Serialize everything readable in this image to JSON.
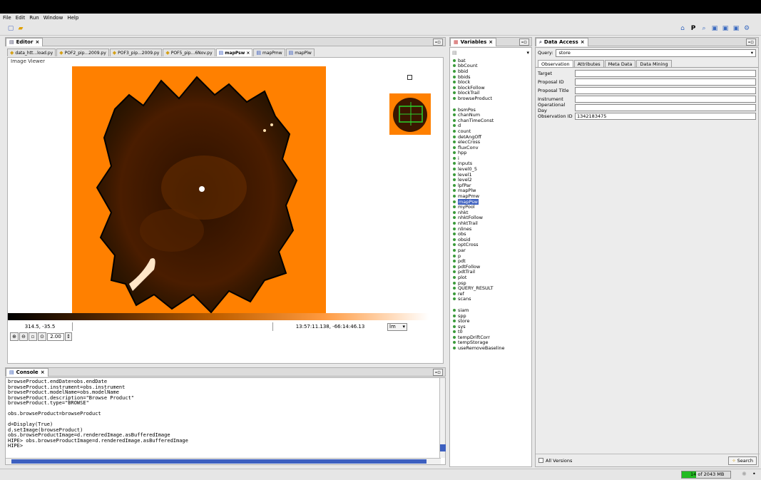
{
  "menu": [
    "File",
    "Edit",
    "Run",
    "Window",
    "Help"
  ],
  "toolbar_right_icons": [
    "home-icon",
    "perspective-p-icon",
    "search-magnify-icon",
    "window-a-icon",
    "window-b-icon",
    "window-c-icon",
    "gear-icon"
  ],
  "editor": {
    "title": "Editor",
    "close": "×",
    "tabs": [
      {
        "label": "data_htt...load.py",
        "kind": "py",
        "active": false
      },
      {
        "label": "POF2_pip...2009.py",
        "kind": "py",
        "active": false
      },
      {
        "label": "POF3_pip...2009.py",
        "kind": "py",
        "active": false
      },
      {
        "label": "POF5_pip...6Nov.py",
        "kind": "py",
        "active": false
      },
      {
        "label": "mapPsw",
        "kind": "map",
        "active": true
      },
      {
        "label": "mapPmw",
        "kind": "map",
        "active": false
      },
      {
        "label": "mapPlw",
        "kind": "map",
        "active": false
      }
    ],
    "image_viewer_label": "Image Viewer",
    "pixel_coord": "314.5, -35.5",
    "sky_coord": "13:57:11.138, -66:14:46.13",
    "scale_mode": "lm",
    "zoom": "2.00"
  },
  "console": {
    "title": "Console",
    "lines": [
      "browseProduct.endDate=obs.endDate",
      "browseProduct.instrument=obs.instrument",
      "browseProduct.modelName=obs.modelName",
      "browseProduct.description=\"Browse Product\"",
      "browseProduct.type=\"BROWSE\"",
      "",
      "obs.browseProduct=browseProduct",
      "",
      "d=Display(True)",
      "d.setImage(browseProduct)",
      "obs.browseProductImage=d.renderedImage.asBufferedImage",
      "HIPE> obs.browseProductImage=d.renderedImage.asBufferedImage",
      "HIPE>"
    ]
  },
  "variables": {
    "title": "Variables",
    "groups": [
      [
        "bat",
        "bbCount",
        "bbid",
        "bbids",
        "block",
        "blockFollow",
        "blockTrail",
        "browseProduct"
      ],
      [
        "bsmPos",
        "chanNum",
        "chanTimeConst",
        "d",
        "count",
        "detAngOff",
        "elecCross",
        "fluxConv",
        "hpp",
        "i",
        "inputs",
        "level0_5",
        "level1",
        "level2",
        "lpfPar",
        "mapPlw",
        "mapPmw",
        "mapPsw",
        "myPool",
        "nhkt",
        "nhktFollow",
        "nhktTrail",
        "nlines",
        "obs",
        "obsid",
        "optCross",
        "par",
        "p",
        "pdt",
        "pdtFollow",
        "pdtTrail",
        "plot",
        "psp",
        "QUERY_RESULT",
        "ref",
        "scans"
      ],
      [
        "siam",
        "spp",
        "store",
        "sys",
        "t0",
        "tempDriftCorr",
        "tempStorage",
        "useRemoveBaseline"
      ]
    ],
    "selected": "mapPsw"
  },
  "data_access": {
    "title": "Data Access",
    "query_label": "Query:",
    "query_value": "store",
    "tabs": [
      "Observation",
      "Attributes",
      "Meta Data",
      "Data Mining"
    ],
    "active_tab": "Observation",
    "fields": [
      {
        "label": "Target",
        "value": ""
      },
      {
        "label": "Proposal ID",
        "value": ""
      },
      {
        "label": "Proposal Title",
        "value": ""
      },
      {
        "label": "Instrument",
        "value": ""
      },
      {
        "label": "Operational Day",
        "value": ""
      },
      {
        "label": "Observation ID",
        "value": "1342183475"
      }
    ],
    "all_versions_label": "All Versions",
    "search_label": "Search"
  },
  "status": {
    "memory": "14 of 2043 MB",
    "memory_fraction": 0.3
  },
  "colors": {
    "map_background": "#ff8000",
    "selection": "#3d60c0",
    "memory_bar": "#22bb22"
  }
}
